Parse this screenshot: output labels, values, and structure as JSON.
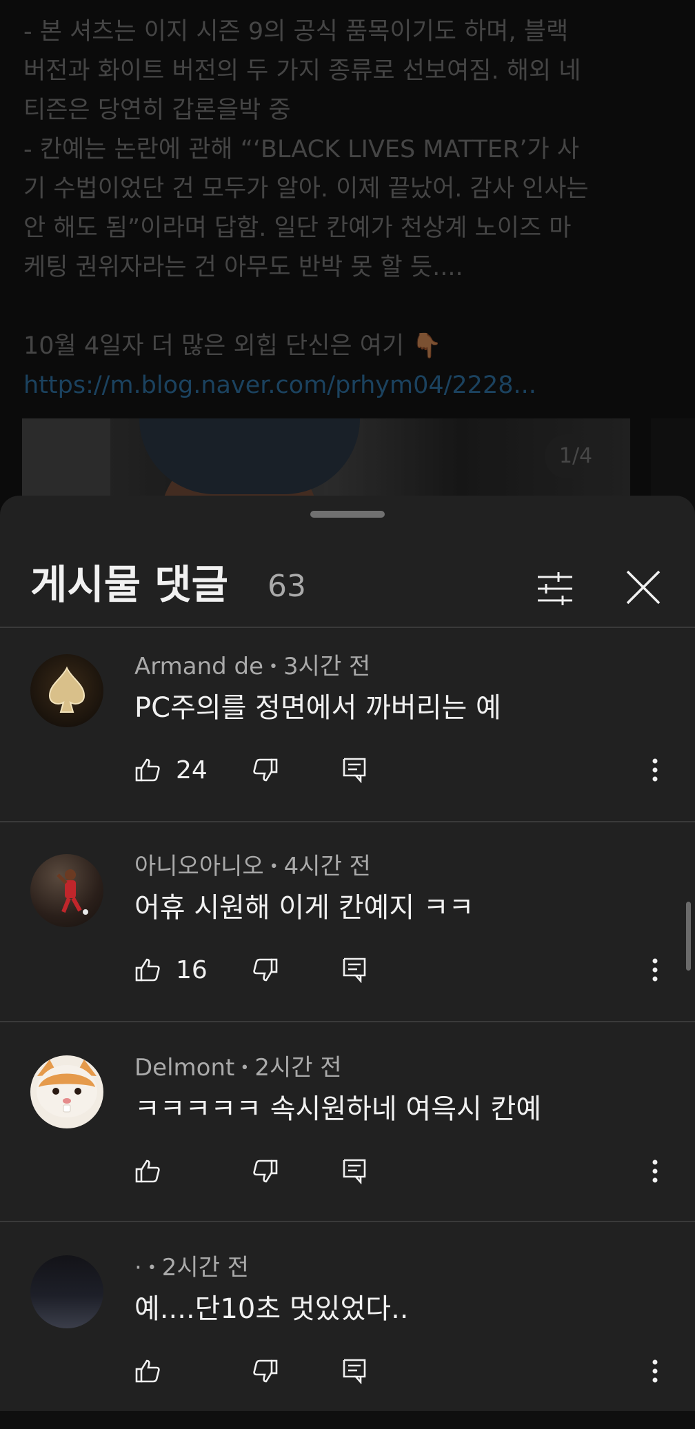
{
  "post": {
    "body": "- 본 셔츠는 이지 시즌 9의 공식 품목이기도 하며, 블랙\n버전과 화이트 버전의 두 가지 종류로 선보여짐. 해외 네\n티즌은 당연히 갑론을박 중\n- 칸예는 논란에 관해 “‘BLACK LIVES MATTER’가 사\n기 수법이었단 건 모두가 알아. 이제 끝났어. 감사 인사는\n안 해도 됨”이라며 답함. 일단 칸예가 천상계 노이즈 마\n케팅 권위자라는 건 아무도 반박 못 할 듯....\n\n10월 4일자 더 많은 외힙 단신은 여기 👇🏾",
    "link": "https://m.blog.naver.com/prhym04/2228...",
    "page_indicator": "1/4"
  },
  "sheet": {
    "title": "게시물 댓글",
    "count": "63",
    "filter_icon": "tune-icon",
    "close_icon": "close-icon"
  },
  "comments": [
    {
      "author": "Armand de",
      "time": "3시간 전",
      "text": "PC주의를 정면에서 까버리는 예",
      "likes": "24",
      "avatar": "spade-logo"
    },
    {
      "author": "아니오아니오",
      "time": "4시간 전",
      "text": "어휴 시원해 이게 칸예지 ㅋㅋ",
      "likes": "16",
      "avatar": "basketball-photo"
    },
    {
      "author": "Delmont",
      "time": "2시간 전",
      "text": "ㅋㅋㅋㅋㅋ 속시원하네 여윽시 칸예",
      "likes": "",
      "avatar": "cat-face"
    },
    {
      "author": "·",
      "time": "2시간 전",
      "text": "예....단10초 멋있었다..",
      "likes": "",
      "avatar": "dark-gradient"
    }
  ],
  "colors": {
    "sheet_bg": "#212121",
    "page_bg": "#0f0f0f",
    "link": "#3ea6ff",
    "secondary_text": "#aaaaaa"
  }
}
